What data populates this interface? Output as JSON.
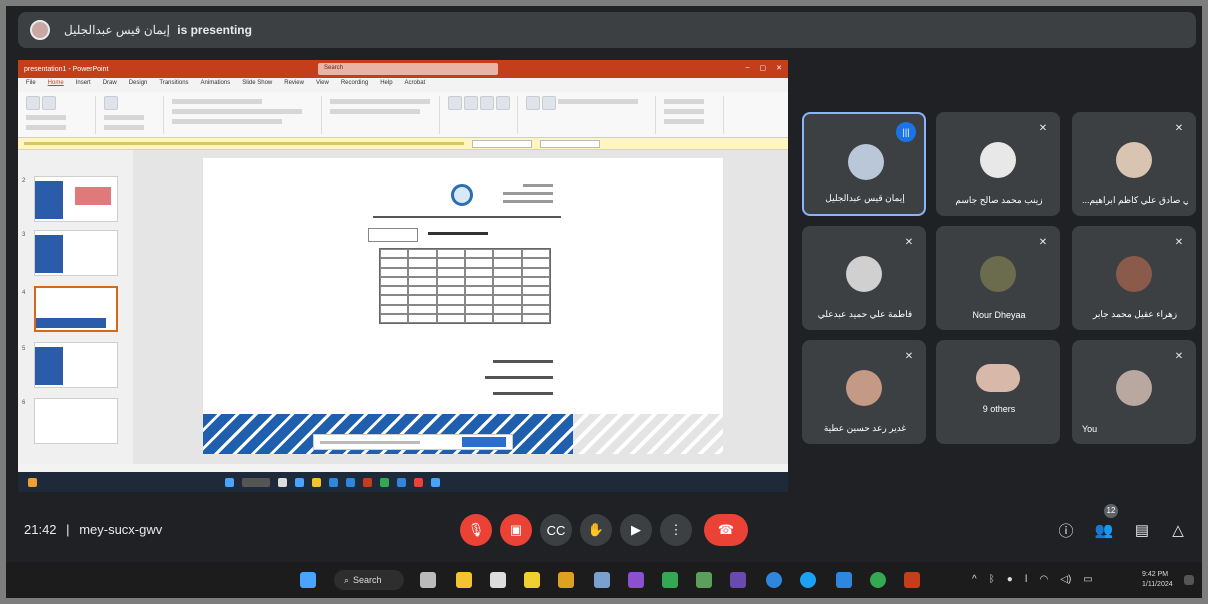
{
  "presenter": {
    "name": "إيمان قيس عبدالجليل",
    "suffix": "is presenting"
  },
  "shared_screen": {
    "powerpoint": {
      "title": "presentation1 - PowerPoint",
      "search_placeholder": "Search",
      "menu": [
        "File",
        "Home",
        "Insert",
        "Draw",
        "Design",
        "Transitions",
        "Animations",
        "Slide Show",
        "Review",
        "View",
        "Recording",
        "Help",
        "Acrobat"
      ],
      "active_menu": "Home"
    },
    "slide_numbers": [
      "2",
      "3",
      "4",
      "5",
      "6"
    ]
  },
  "participants": [
    {
      "name": "إيمان قيس عبدالجليل",
      "speaking": true,
      "color": "#b9c7d8"
    },
    {
      "name": "زينب محمد صالح جاسم",
      "speaking": false,
      "color": "#e8e8e8"
    },
    {
      "name": "...تي صادق علي كاظم ابراهيم",
      "speaking": false,
      "color": "#d8c4b0"
    },
    {
      "name": "فاطمة علي حميد عبدعلي",
      "speaking": false,
      "color": "#d0d0d0"
    },
    {
      "name": "Nour Dheyaa",
      "speaking": false,
      "color": "#6b6b4e"
    },
    {
      "name": "زهراء عقيل محمد جابر",
      "speaking": false,
      "color": "#8a5a4a"
    },
    {
      "name": "غدير رعد حسين عطية",
      "speaking": false,
      "color": "#c49a86"
    },
    {
      "name": "9 others",
      "speaking": false,
      "color": "#d8b8a8"
    },
    {
      "name": "You",
      "speaking": false,
      "color": "#b8a8a0"
    }
  ],
  "meeting": {
    "time": "21:42",
    "separator": "|",
    "code": "mey-sucx-gwv",
    "participant_count": "12"
  },
  "controls": {
    "mic": "mic-off-icon",
    "camera": "camera-off-icon",
    "captions": "captions-icon",
    "raise_hand": "hand-icon",
    "present": "present-icon",
    "more": "more-icon",
    "end": "end-call-icon"
  },
  "taskbar": {
    "search_label": "Search",
    "clock_time": "9:42 PM",
    "clock_date": "1/11/2024"
  },
  "colors": {
    "meet_bg": "#202124",
    "tile": "#3c4043",
    "danger": "#ea4335",
    "accent": "#8ab4f8",
    "ppt": "#c43e1c"
  }
}
